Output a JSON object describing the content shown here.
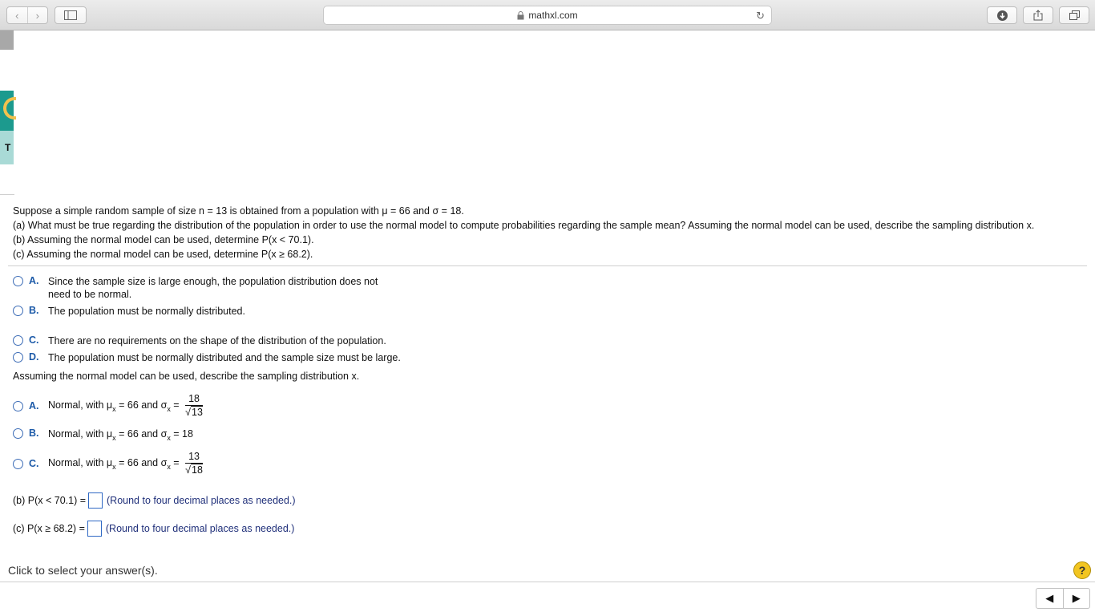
{
  "browser": {
    "url": "mathxl.com",
    "back_glyph": "‹",
    "forward_glyph": "›",
    "reload_glyph": "↻"
  },
  "sidebar": {
    "tab_letter": "T"
  },
  "question": {
    "intro_pre": "Suppose a simple random sample of size n = 13 is obtained from a population with μ = 66 and σ = 18.",
    "part_a": "(a) What must be true regarding the distribution of the population in order to use the normal model to compute probabilities regarding the sample mean? Assuming the normal model can be used, describe the sampling distribution x.",
    "part_b": "(b) Assuming the normal model can be used, determine P(x < 70.1).",
    "part_c": "(c) Assuming the normal model can be used, determine P(x ≥ 68.2)."
  },
  "options_a": [
    {
      "letter": "A.",
      "text": "Since the sample size is large enough, the population distribution does not need to be normal."
    },
    {
      "letter": "B.",
      "text": "The population must be normally distributed."
    },
    {
      "letter": "C.",
      "text": "There are no requirements on the shape of the distribution of the population."
    },
    {
      "letter": "D.",
      "text": "The population must be normally distributed and the sample size must be large."
    }
  ],
  "sampling_prompt": "Assuming the normal model can be used, describe the sampling distribution x.",
  "options_b": [
    {
      "letter": "A.",
      "prefix": "Normal, with μ",
      "mid": " = 66 and σ",
      "eq": " =",
      "num": "18",
      "den": "13"
    },
    {
      "letter": "B.",
      "prefix": "Normal, with μ",
      "mid": " = 66 and σ",
      "eq": " = 18"
    },
    {
      "letter": "C.",
      "prefix": "Normal, with μ",
      "mid": " = 66 and σ",
      "eq": " =",
      "num": "13",
      "den": "18"
    }
  ],
  "sub_x": "x",
  "answers": {
    "b_label": "(b) P(x < 70.1) =",
    "c_label": "(c) P(x ≥ 68.2) =",
    "hint": "(Round to four decimal places as needed.)"
  },
  "footer": {
    "status": "Click to select your answer(s).",
    "help": "?",
    "prev": "◀",
    "next": "▶"
  }
}
